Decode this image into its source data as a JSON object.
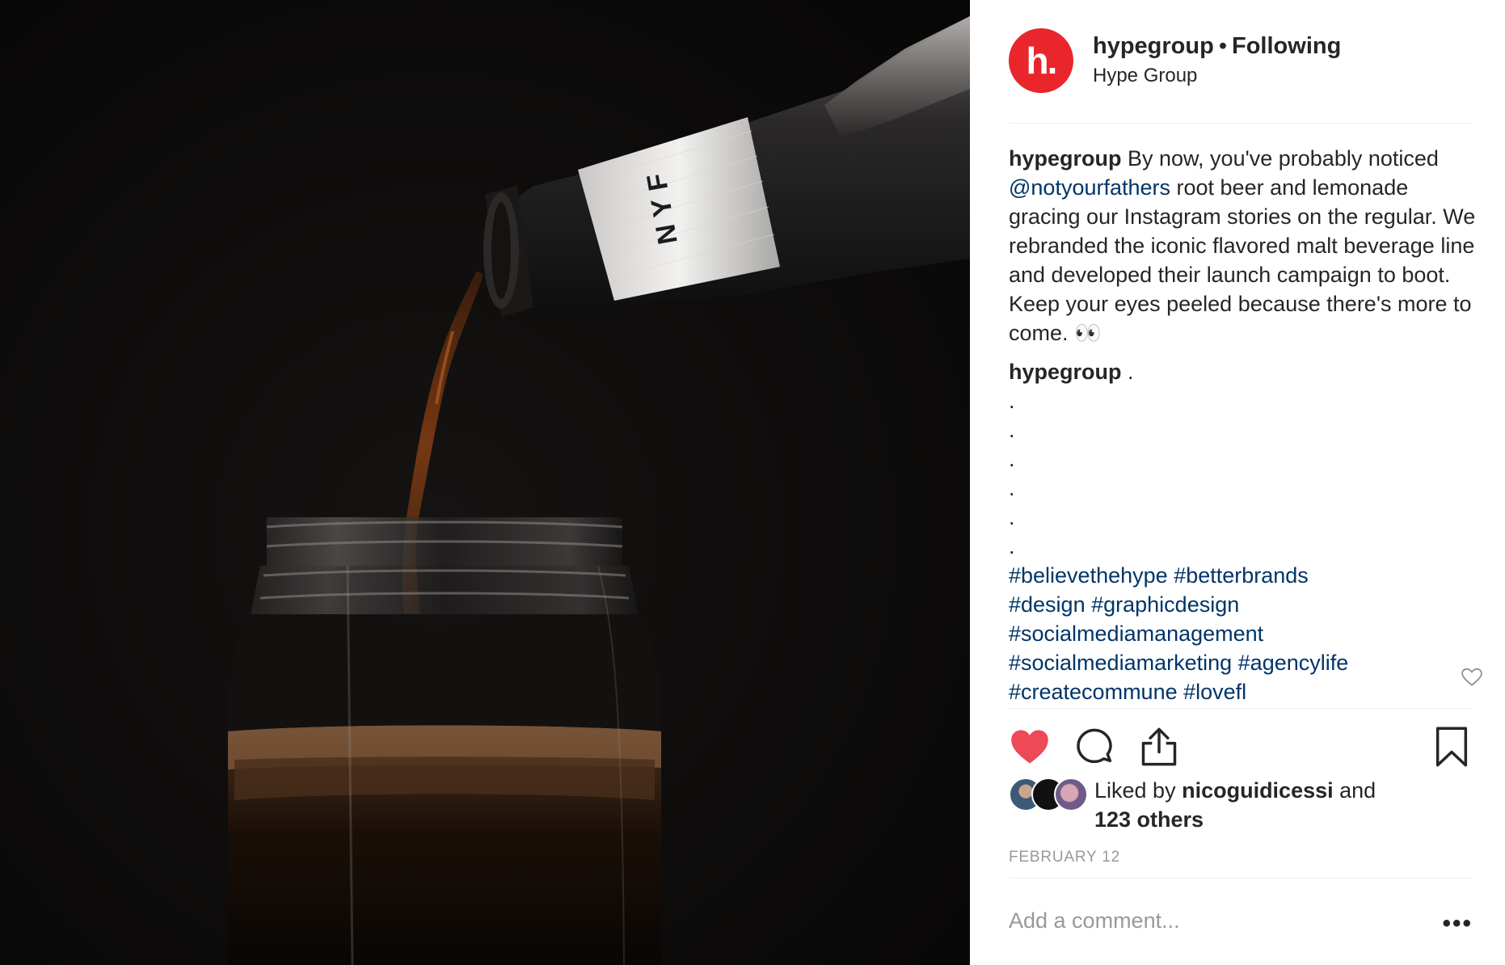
{
  "header": {
    "username": "hypegroup",
    "separator": "•",
    "follow_status": "Following",
    "location": "Hype Group",
    "avatar_letter": "h."
  },
  "caption": {
    "author": "hypegroup",
    "text_before_mention": " By now, you've probably noticed ",
    "mention": "@notyourfathers",
    "text_after_mention": " root beer and lemonade gracing our Instagram stories on the regular. We rebranded the iconic flavored malt beverage line and developed their launch campaign to boot. Keep your eyes peeled because there's more to come. 👀"
  },
  "comment": {
    "author": "hypegroup",
    "first": " .",
    "dots": [
      ".",
      ".",
      ".",
      ".",
      ".",
      "."
    ],
    "hashtags": [
      "#believethehype",
      "#betterbrands",
      "#design",
      "#graphicdesign",
      "#socialmediamanagement",
      "#socialmediamarketing",
      "#agencylife",
      "#createcommune",
      "#lovefl"
    ]
  },
  "likes": {
    "prefix": "Liked by ",
    "user": "nicoguidicessi",
    "connector": " and",
    "others": "123 others"
  },
  "date": "FEBRUARY 12",
  "comment_input": {
    "placeholder": "Add a comment..."
  },
  "more_label": "•••",
  "photo": {
    "bottle_label_text": "NYF"
  },
  "icons": {
    "like": "heart-filled-icon",
    "comment": "speech-bubble-icon",
    "share": "share-upload-icon",
    "save": "bookmark-icon",
    "comment_like": "heart-outline-icon"
  },
  "colors": {
    "brand": "#e8262c",
    "link": "#003569",
    "liked_heart": "#ed4956",
    "muted": "#999999"
  }
}
